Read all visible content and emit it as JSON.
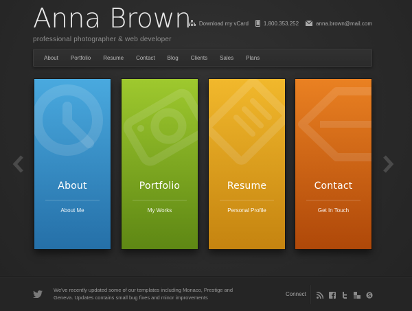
{
  "site": {
    "name": "Anna Brown",
    "tagline": "professional photographer & web developer"
  },
  "contact": {
    "vcard_label": "Download my vCard",
    "phone": "1.800.353.252",
    "email": "anna.brown@mail.com"
  },
  "nav": {
    "items": [
      "About",
      "Portfolio",
      "Resume",
      "Contact",
      "Blog",
      "Clients",
      "Sales",
      "Plans"
    ]
  },
  "cards": [
    {
      "title": "About",
      "subtitle": "About Me",
      "color": "#3aa2dc",
      "icon": "clock-icon"
    },
    {
      "title": "Portfolio",
      "subtitle": "My Works",
      "color": "#96c41c",
      "icon": "camera-icon"
    },
    {
      "title": "Resume",
      "subtitle": "Personal Profile",
      "color": "#f0b21a",
      "icon": "document-icon"
    },
    {
      "title": "Contact",
      "subtitle": "Get In Touch",
      "color": "#e8760f",
      "icon": "tag-icon"
    }
  ],
  "footer": {
    "news": "We've recently updated some of our templates including Monaco, Prestige and Geneva. Updates contains small bug fixes and minor improvements",
    "connect_label": "Connect",
    "social_icons": [
      "rss-icon",
      "facebook-icon",
      "twitter-icon",
      "delicious-icon",
      "skype-icon"
    ]
  }
}
